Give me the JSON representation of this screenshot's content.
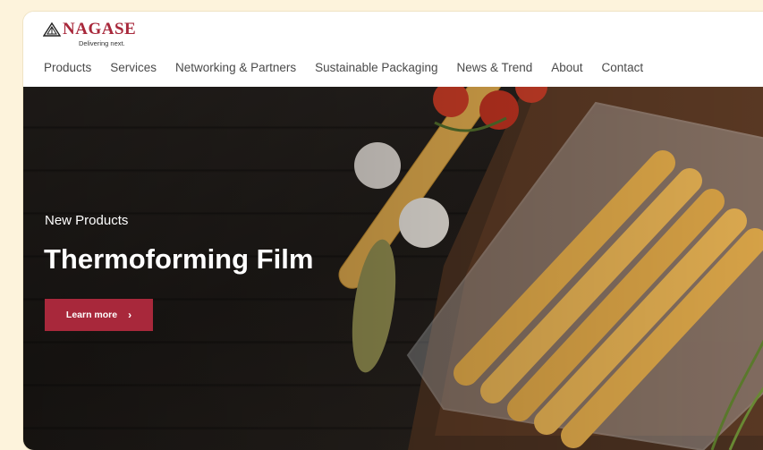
{
  "brand": {
    "name": "NAGASE",
    "tagline": "Delivering next.",
    "color": "#a8283b"
  },
  "nav": {
    "items": [
      {
        "label": "Products"
      },
      {
        "label": "Services"
      },
      {
        "label": "Networking & Partners"
      },
      {
        "label": "Sustainable Packaging"
      },
      {
        "label": "News & Trend"
      },
      {
        "label": "About"
      },
      {
        "label": "Contact"
      }
    ]
  },
  "hero": {
    "eyebrow": "New Products",
    "title": "Thermoforming Film",
    "cta_label": "Learn more",
    "cta_icon": "chevron-right-icon",
    "image": "sausages-in-vacuum-pack-icon"
  }
}
